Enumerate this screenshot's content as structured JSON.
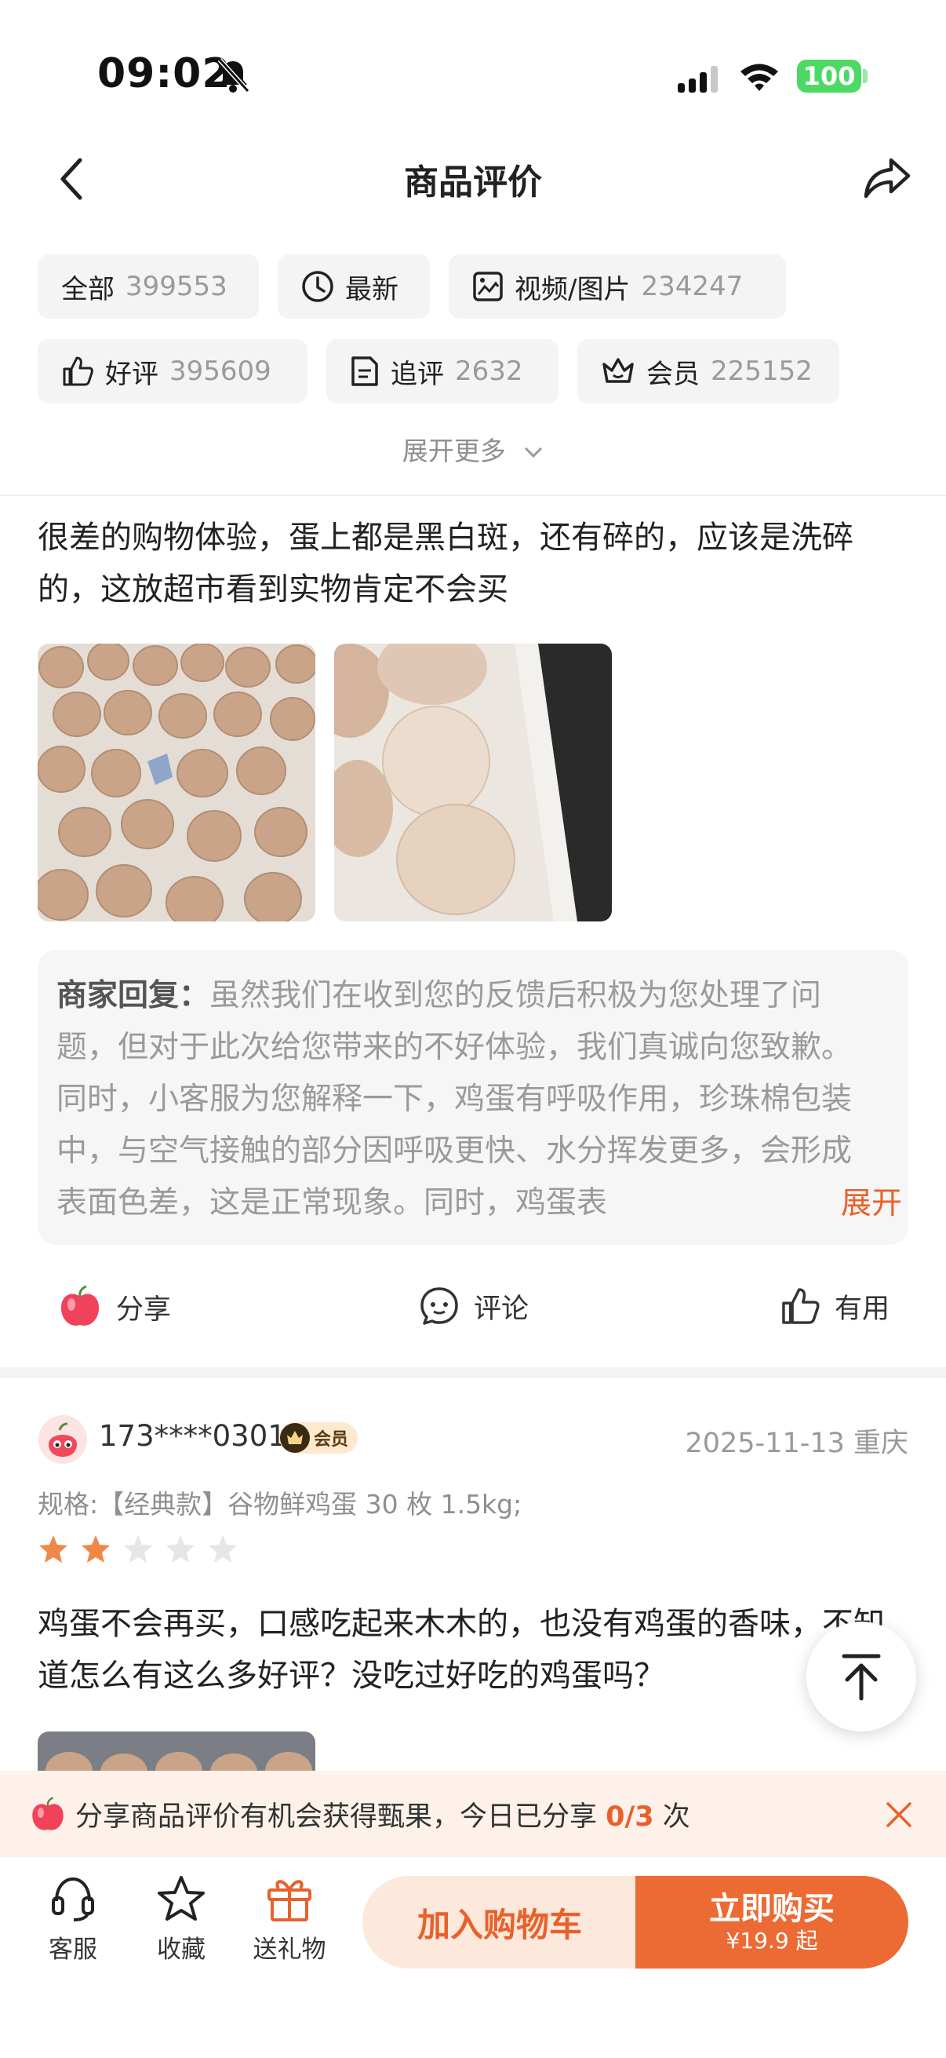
{
  "status_bar": {
    "time": "09:02",
    "battery": "100"
  },
  "header": {
    "title": "商品评价"
  },
  "filters": [
    {
      "label": "全部",
      "count": "399553"
    },
    {
      "label": "最新",
      "count": ""
    },
    {
      "label": "视频/图片",
      "count": "234247"
    },
    {
      "label": "好评",
      "count": "395609"
    },
    {
      "label": "追评",
      "count": "2632"
    },
    {
      "label": "会员",
      "count": "225152"
    }
  ],
  "expand_more": "展开更多",
  "review1": {
    "text": "很差的购物体验，蛋上都是黑白斑，还有碎的，应该是洗碎的，这放超市看到实物肯定不会买",
    "reply_label": "商家回复：",
    "reply_text": "虽然我们在收到您的反馈后积极为您处理了问题，但对于此次给您带来的不好体验，我们真诚向您致歉。同时，小客服为您解释一下，鸡蛋有呼吸作用，珍珠棉包装中，与空气接触的部分因呼吸更快、水分挥发更多，会形成表面色差，这是正常现象。同时，鸡蛋表",
    "expand": "展开",
    "actions": {
      "share": "分享",
      "comment": "评论",
      "useful": "有用"
    }
  },
  "review2": {
    "user": "173****0301",
    "vip": "会员",
    "date": "2025-11-13 重庆",
    "spec": "规格:【经典款】谷物鲜鸡蛋 30 枚 1.5kg;",
    "rating": 2,
    "rating_max": 5,
    "text": "鸡蛋不会再买，口感吃起来木木的，也没有鸡蛋的香味，不知道怎么有这么多好评？没吃过好吃的鸡蛋吗？"
  },
  "share_banner": {
    "prefix": "分享商品评价有机会获得甄果，今日已分享 ",
    "progress": "0/3",
    "suffix": " 次"
  },
  "bottom_bar": {
    "service": "客服",
    "favorite": "收藏",
    "gift": "送礼物",
    "add_to_cart": "加入购物车",
    "buy_now": "立即购买",
    "price": "¥19.9 起"
  },
  "colors": {
    "accent": "#e8612c",
    "buy": "#ec6a33",
    "star_on": "#f0884a",
    "star_off": "#e6e6e6"
  }
}
